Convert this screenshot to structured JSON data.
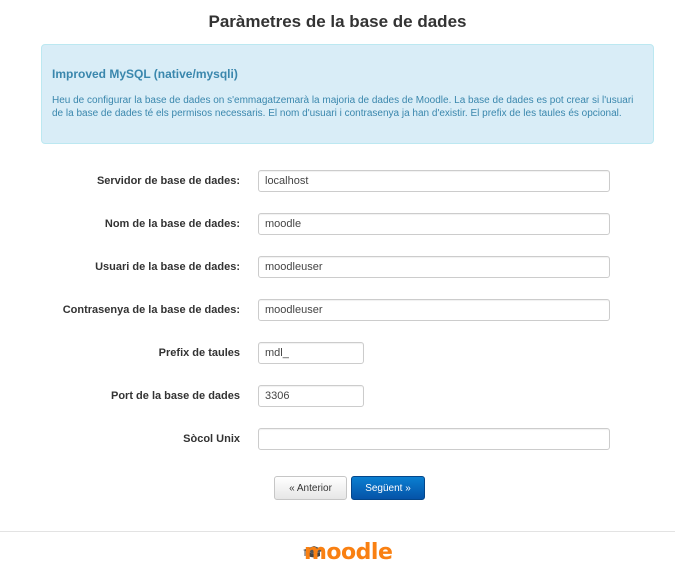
{
  "page": {
    "title": "Paràmetres de la base de dades"
  },
  "info": {
    "heading": "Improved MySQL (native/mysqli)",
    "text": "Heu de configurar la base de dades on s'emmagatzemarà la majoria de dades de Moodle. La base de dades es pot crear si l'usuari de la base de dades té els permisos necessaris. El nom d'usuari i contrasenya ja han d'existir. El prefix de les taules és opcional."
  },
  "form": {
    "server": {
      "label": "Servidor de base de dades:",
      "value": "localhost"
    },
    "dbname": {
      "label": "Nom de la base de dades:",
      "value": "moodle"
    },
    "dbuser": {
      "label": "Usuari de la base de dades:",
      "value": "moodleuser"
    },
    "dbpass": {
      "label": "Contrasenya de la base de dades:",
      "value": "moodleuser"
    },
    "prefix": {
      "label": "Prefix de taules",
      "value": "mdl_"
    },
    "port": {
      "label": "Port de la base de dades",
      "value": "3306"
    },
    "socket": {
      "label": "Sòcol Unix",
      "value": ""
    }
  },
  "buttons": {
    "back": "« Anterior",
    "next": "Següent »"
  },
  "footer": {
    "logo_text": "moodle",
    "logo_icon": "mortarboard-icon",
    "brand_color": "#f98012"
  }
}
